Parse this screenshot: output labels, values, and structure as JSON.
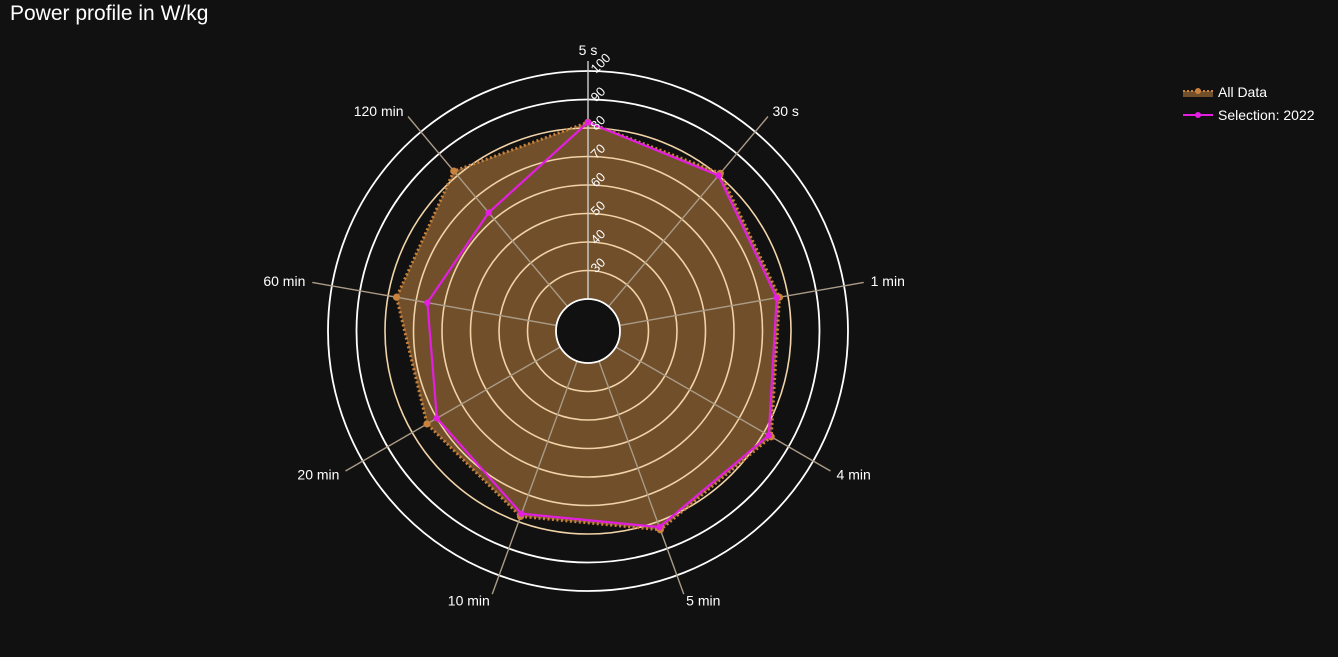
{
  "title": "Power profile in W/kg",
  "colors": {
    "background": "#111111",
    "all_fill": "#714f2a",
    "all_line": "#c8823c",
    "selection": "#e31ee0",
    "grid_outer": "#ffffff",
    "grid_inner": "#f1d3a8",
    "spoke": "#aa9b87"
  },
  "chart_data": {
    "type": "radar",
    "title": "Power profile in W/kg",
    "categories": [
      "5 s",
      "30 s",
      "1 min",
      "4 min",
      "5 min",
      "10 min",
      "20 min",
      "60 min",
      "120 min"
    ],
    "radial_ticks": [
      "30",
      "40",
      "50",
      "60",
      "70",
      "80",
      "90",
      "100"
    ],
    "radial_range": [
      20,
      100
    ],
    "legend_position": "top-right",
    "series": [
      {
        "name": "All Data",
        "style": "dotted-line-filled",
        "values": [
          82,
          81,
          77,
          83,
          83,
          78,
          74,
          77,
          82
        ]
      },
      {
        "name": "Selection: 2022",
        "style": "line-markers",
        "values": [
          82,
          80,
          76,
          82,
          82,
          77,
          70,
          66,
          63
        ]
      }
    ]
  }
}
